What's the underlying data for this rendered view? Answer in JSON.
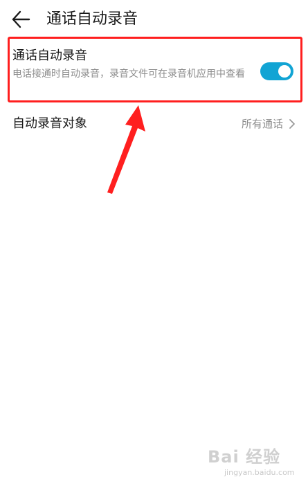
{
  "header": {
    "back_icon": "arrow-left-icon",
    "title": "通话自动录音"
  },
  "auto_record": {
    "title": "通话自动录音",
    "description": "电话接通时自动录音，录音文件可在录音机应用中查看",
    "toggle_on": true,
    "toggle_color": "#11a4d4"
  },
  "record_target": {
    "label": "自动录音对象",
    "value": "所有通话",
    "chevron_icon": "chevron-right-icon"
  },
  "annotation": {
    "highlight_color": "#ff1f1f",
    "arrow_color": "#ff1f1f"
  },
  "watermark": {
    "logo": "Bai 经验",
    "url": "jingyan.baidu.com"
  }
}
